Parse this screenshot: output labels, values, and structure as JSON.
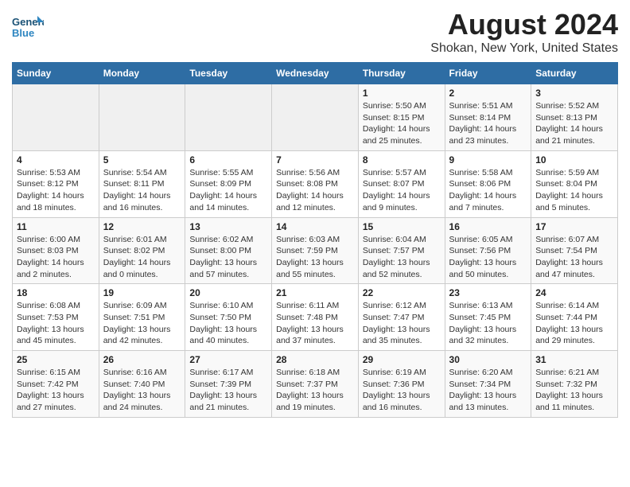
{
  "logo": {
    "line1": "General",
    "line2": "Blue"
  },
  "title": "August 2024",
  "subtitle": "Shokan, New York, United States",
  "days_of_week": [
    "Sunday",
    "Monday",
    "Tuesday",
    "Wednesday",
    "Thursday",
    "Friday",
    "Saturday"
  ],
  "weeks": [
    [
      {
        "day": "",
        "info": ""
      },
      {
        "day": "",
        "info": ""
      },
      {
        "day": "",
        "info": ""
      },
      {
        "day": "",
        "info": ""
      },
      {
        "day": "1",
        "info": "Sunrise: 5:50 AM\nSunset: 8:15 PM\nDaylight: 14 hours\nand 25 minutes."
      },
      {
        "day": "2",
        "info": "Sunrise: 5:51 AM\nSunset: 8:14 PM\nDaylight: 14 hours\nand 23 minutes."
      },
      {
        "day": "3",
        "info": "Sunrise: 5:52 AM\nSunset: 8:13 PM\nDaylight: 14 hours\nand 21 minutes."
      }
    ],
    [
      {
        "day": "4",
        "info": "Sunrise: 5:53 AM\nSunset: 8:12 PM\nDaylight: 14 hours\nand 18 minutes."
      },
      {
        "day": "5",
        "info": "Sunrise: 5:54 AM\nSunset: 8:11 PM\nDaylight: 14 hours\nand 16 minutes."
      },
      {
        "day": "6",
        "info": "Sunrise: 5:55 AM\nSunset: 8:09 PM\nDaylight: 14 hours\nand 14 minutes."
      },
      {
        "day": "7",
        "info": "Sunrise: 5:56 AM\nSunset: 8:08 PM\nDaylight: 14 hours\nand 12 minutes."
      },
      {
        "day": "8",
        "info": "Sunrise: 5:57 AM\nSunset: 8:07 PM\nDaylight: 14 hours\nand 9 minutes."
      },
      {
        "day": "9",
        "info": "Sunrise: 5:58 AM\nSunset: 8:06 PM\nDaylight: 14 hours\nand 7 minutes."
      },
      {
        "day": "10",
        "info": "Sunrise: 5:59 AM\nSunset: 8:04 PM\nDaylight: 14 hours\nand 5 minutes."
      }
    ],
    [
      {
        "day": "11",
        "info": "Sunrise: 6:00 AM\nSunset: 8:03 PM\nDaylight: 14 hours\nand 2 minutes."
      },
      {
        "day": "12",
        "info": "Sunrise: 6:01 AM\nSunset: 8:02 PM\nDaylight: 14 hours\nand 0 minutes."
      },
      {
        "day": "13",
        "info": "Sunrise: 6:02 AM\nSunset: 8:00 PM\nDaylight: 13 hours\nand 57 minutes."
      },
      {
        "day": "14",
        "info": "Sunrise: 6:03 AM\nSunset: 7:59 PM\nDaylight: 13 hours\nand 55 minutes."
      },
      {
        "day": "15",
        "info": "Sunrise: 6:04 AM\nSunset: 7:57 PM\nDaylight: 13 hours\nand 52 minutes."
      },
      {
        "day": "16",
        "info": "Sunrise: 6:05 AM\nSunset: 7:56 PM\nDaylight: 13 hours\nand 50 minutes."
      },
      {
        "day": "17",
        "info": "Sunrise: 6:07 AM\nSunset: 7:54 PM\nDaylight: 13 hours\nand 47 minutes."
      }
    ],
    [
      {
        "day": "18",
        "info": "Sunrise: 6:08 AM\nSunset: 7:53 PM\nDaylight: 13 hours\nand 45 minutes."
      },
      {
        "day": "19",
        "info": "Sunrise: 6:09 AM\nSunset: 7:51 PM\nDaylight: 13 hours\nand 42 minutes."
      },
      {
        "day": "20",
        "info": "Sunrise: 6:10 AM\nSunset: 7:50 PM\nDaylight: 13 hours\nand 40 minutes."
      },
      {
        "day": "21",
        "info": "Sunrise: 6:11 AM\nSunset: 7:48 PM\nDaylight: 13 hours\nand 37 minutes."
      },
      {
        "day": "22",
        "info": "Sunrise: 6:12 AM\nSunset: 7:47 PM\nDaylight: 13 hours\nand 35 minutes."
      },
      {
        "day": "23",
        "info": "Sunrise: 6:13 AM\nSunset: 7:45 PM\nDaylight: 13 hours\nand 32 minutes."
      },
      {
        "day": "24",
        "info": "Sunrise: 6:14 AM\nSunset: 7:44 PM\nDaylight: 13 hours\nand 29 minutes."
      }
    ],
    [
      {
        "day": "25",
        "info": "Sunrise: 6:15 AM\nSunset: 7:42 PM\nDaylight: 13 hours\nand 27 minutes."
      },
      {
        "day": "26",
        "info": "Sunrise: 6:16 AM\nSunset: 7:40 PM\nDaylight: 13 hours\nand 24 minutes."
      },
      {
        "day": "27",
        "info": "Sunrise: 6:17 AM\nSunset: 7:39 PM\nDaylight: 13 hours\nand 21 minutes."
      },
      {
        "day": "28",
        "info": "Sunrise: 6:18 AM\nSunset: 7:37 PM\nDaylight: 13 hours\nand 19 minutes."
      },
      {
        "day": "29",
        "info": "Sunrise: 6:19 AM\nSunset: 7:36 PM\nDaylight: 13 hours\nand 16 minutes."
      },
      {
        "day": "30",
        "info": "Sunrise: 6:20 AM\nSunset: 7:34 PM\nDaylight: 13 hours\nand 13 minutes."
      },
      {
        "day": "31",
        "info": "Sunrise: 6:21 AM\nSunset: 7:32 PM\nDaylight: 13 hours\nand 11 minutes."
      }
    ]
  ]
}
